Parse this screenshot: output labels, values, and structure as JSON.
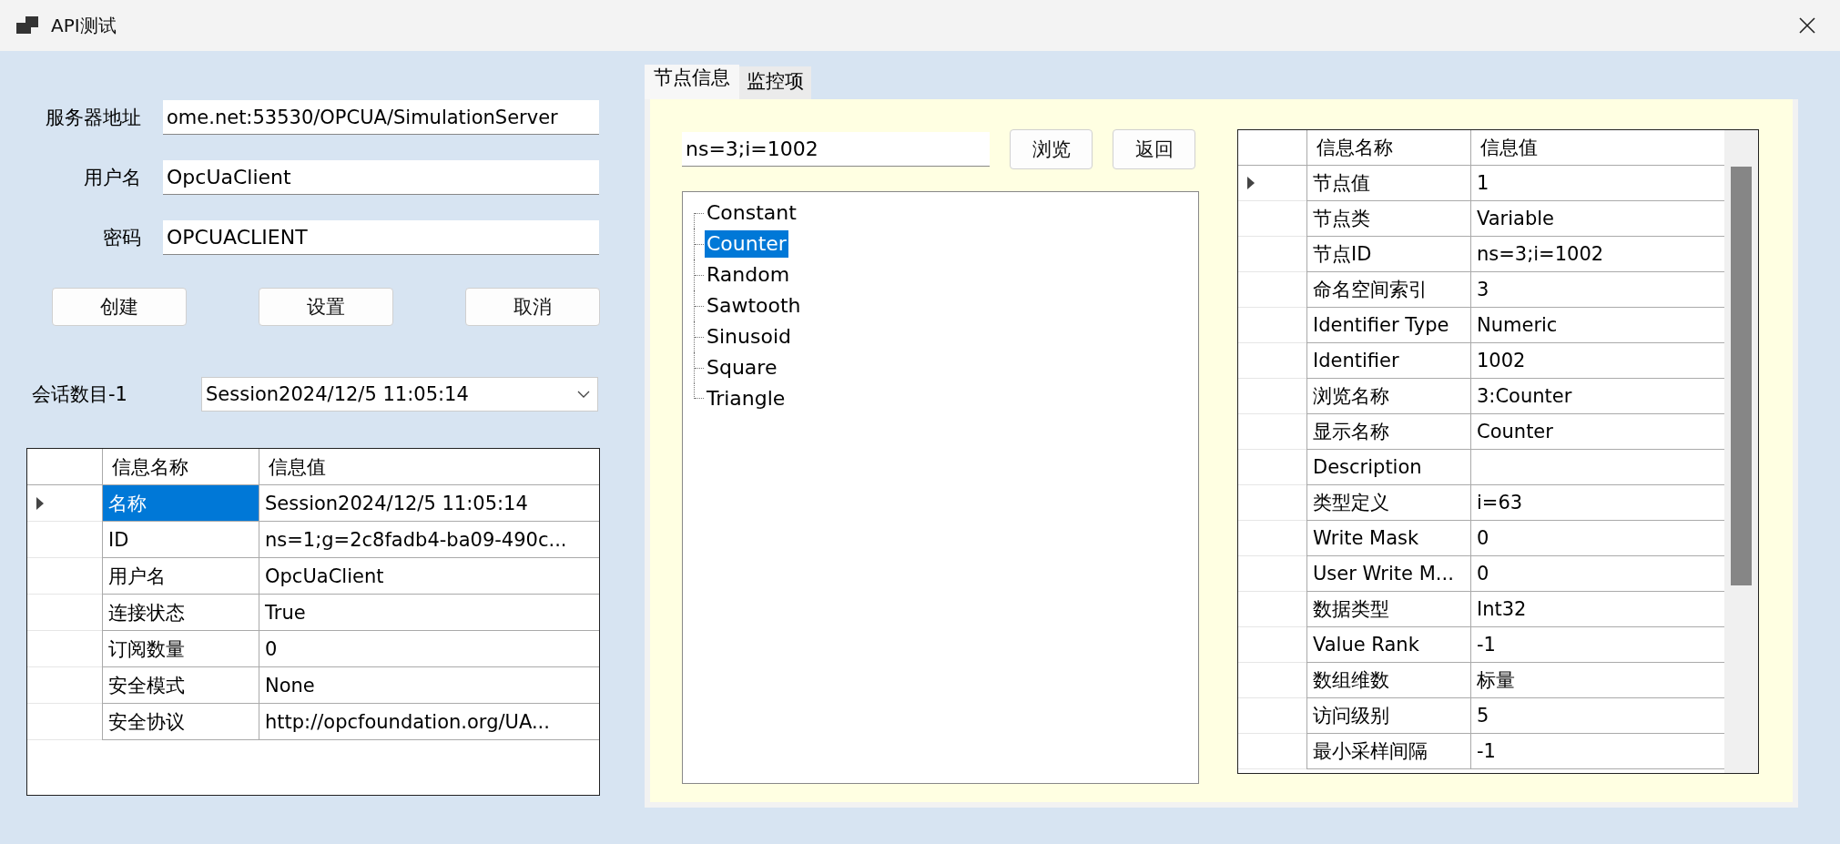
{
  "window": {
    "title": "API测试"
  },
  "connection": {
    "fields": [
      {
        "label": "服务器地址",
        "value": "ome.net:53530/OPCUA/SimulationServer"
      },
      {
        "label": "用户名",
        "value": "OpcUaClient"
      },
      {
        "label": "密码",
        "value": "OPCUACLIENT"
      }
    ],
    "buttons": [
      "创建",
      "设置",
      "取消"
    ],
    "session": {
      "label": "会话数目-1",
      "value": "Session2024/12/5 11:05:14"
    }
  },
  "session_grid": {
    "columns": [
      "信息名称",
      "信息值"
    ],
    "rows": [
      {
        "name": "名称",
        "value": "Session2024/12/5 11:05:14",
        "selected": true
      },
      {
        "name": "ID",
        "value": "ns=1;g=2c8fadb4-ba09-490c...",
        "selected": false
      },
      {
        "name": "用户名",
        "value": "OpcUaClient",
        "selected": false
      },
      {
        "name": "连接状态",
        "value": "True",
        "selected": false
      },
      {
        "name": "订阅数量",
        "value": "0",
        "selected": false
      },
      {
        "name": "安全模式",
        "value": "None",
        "selected": false
      },
      {
        "name": "安全协议",
        "value": "http://opcfoundation.org/UA...",
        "selected": false
      }
    ]
  },
  "tabs": [
    {
      "label": "节点信息",
      "selected": true
    },
    {
      "label": "监控项",
      "selected": false
    }
  ],
  "node_browser": {
    "node_id": "ns=3;i=1002",
    "buttons": [
      "浏览",
      "返回"
    ],
    "tree": [
      {
        "label": "Constant",
        "selected": false
      },
      {
        "label": "Counter",
        "selected": true
      },
      {
        "label": "Random",
        "selected": false
      },
      {
        "label": "Sawtooth",
        "selected": false
      },
      {
        "label": "Sinusoid",
        "selected": false
      },
      {
        "label": "Square",
        "selected": false
      },
      {
        "label": "Triangle",
        "selected": false
      }
    ]
  },
  "node_grid": {
    "columns": [
      "信息名称",
      "信息值"
    ],
    "rows": [
      {
        "name": "节点值",
        "value": "1",
        "selected": true
      },
      {
        "name": "节点类",
        "value": "Variable",
        "selected": false
      },
      {
        "name": "节点ID",
        "value": "ns=3;i=1002",
        "selected": false
      },
      {
        "name": "命名空间索引",
        "value": "3",
        "selected": false
      },
      {
        "name": "Identifier Type",
        "value": "Numeric",
        "selected": false
      },
      {
        "name": "Identifier",
        "value": "1002",
        "selected": false
      },
      {
        "name": "浏览名称",
        "value": "3:Counter",
        "selected": false
      },
      {
        "name": "显示名称",
        "value": "Counter",
        "selected": false
      },
      {
        "name": "Description",
        "value": "",
        "selected": false
      },
      {
        "name": "类型定义",
        "value": "i=63",
        "selected": false
      },
      {
        "name": "Write Mask",
        "value": "0",
        "selected": false
      },
      {
        "name": "User Write M...",
        "value": "0",
        "selected": false
      },
      {
        "name": "数据类型",
        "value": "Int32",
        "selected": false
      },
      {
        "name": "Value Rank",
        "value": "-1",
        "selected": false
      },
      {
        "name": "数组维数",
        "value": "标量",
        "selected": false
      },
      {
        "name": "访问级别",
        "value": "5",
        "selected": false
      },
      {
        "name": "最小采样间隔",
        "value": "-1",
        "selected": false
      }
    ]
  }
}
